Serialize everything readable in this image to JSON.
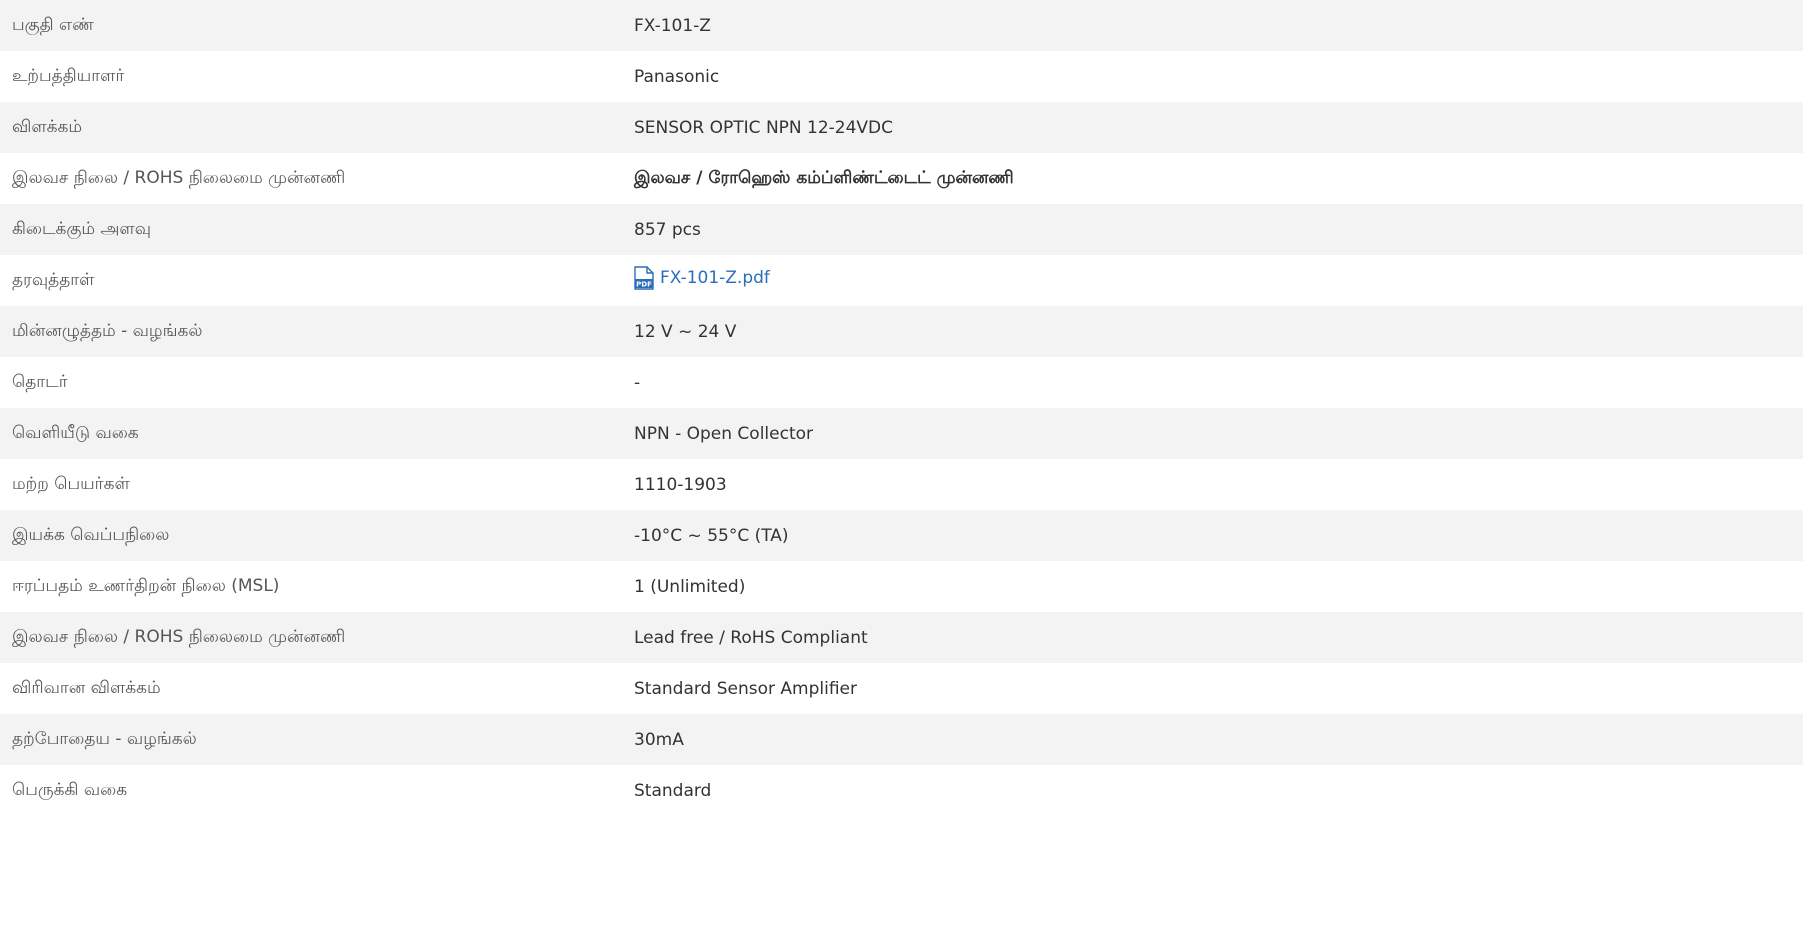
{
  "colors": {
    "row_alt": "#f3f3f3",
    "text": "#333333",
    "link": "#2a6ebb",
    "pdf_icon": "#2a6ebb"
  },
  "rows": [
    {
      "label": "பகுதி எண்",
      "value": "FX-101-Z"
    },
    {
      "label": "உற்பத்தியாளர்",
      "value": "Panasonic"
    },
    {
      "label": "விளக்கம்",
      "value": "SENSOR OPTIC NPN 12-24VDC"
    },
    {
      "label": "இலவச நிலை / ROHS நிலைமை முன்னணி",
      "value": "இலவச / ரோஹெஸ் கம்ப்ளிண்ட்டைட் முன்னணி"
    },
    {
      "label": "கிடைக்கும் அளவு",
      "value": "857 pcs"
    },
    {
      "label": "தரவுத்தாள்",
      "value": "FX-101-Z.pdf",
      "icon": "pdf-icon"
    },
    {
      "label": "மின்னழுத்தம் - வழங்கல்",
      "value": "12 V ~ 24 V"
    },
    {
      "label": "தொடர்",
      "value": "-"
    },
    {
      "label": "வெளியீடு வகை",
      "value": "NPN - Open Collector"
    },
    {
      "label": "மற்ற பெயர்கள்",
      "value": "1110-1903"
    },
    {
      "label": "இயக்க வெப்பநிலை",
      "value": "-10°C ~ 55°C (TA)"
    },
    {
      "label": "ஈரப்பதம் உணர்திறன் நிலை (MSL)",
      "value": "1 (Unlimited)"
    },
    {
      "label": "இலவச நிலை / ROHS நிலைமை முன்னணி",
      "value": "Lead free / RoHS Compliant"
    },
    {
      "label": "விரிவான விளக்கம்",
      "value": "Standard Sensor Amplifier"
    },
    {
      "label": "தற்போதைய - வழங்கல்",
      "value": "30mA"
    },
    {
      "label": "பெருக்கி வகை",
      "value": "Standard"
    }
  ]
}
